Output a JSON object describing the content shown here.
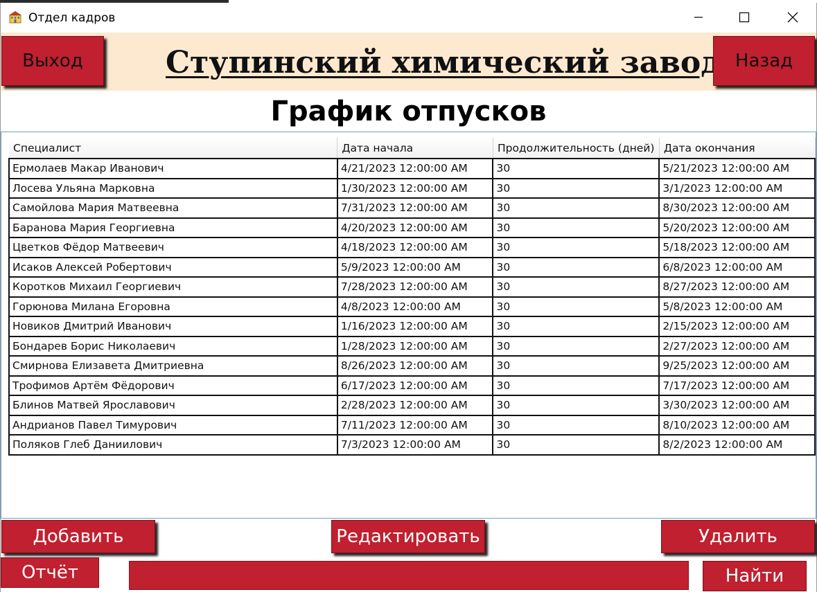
{
  "window": {
    "title": "Отдел кадров",
    "icon": "building-icon"
  },
  "header": {
    "exit_label": "Выход",
    "company": "Ступинский химический завод",
    "back_label": "Назад"
  },
  "page_title": "График отпусков",
  "table": {
    "columns": [
      "Специалист",
      "Дата начала",
      "Продолжительность (дней)",
      "Дата окончания"
    ],
    "rows": [
      [
        "Ермолаев Макар Иванович",
        "4/21/2023 12:00:00 AM",
        "30",
        "5/21/2023 12:00:00 AM"
      ],
      [
        "Лосева Ульяна Марковна",
        "1/30/2023 12:00:00 AM",
        "30",
        "3/1/2023 12:00:00 AM"
      ],
      [
        "Самойлова Мария Матвеевна",
        "7/31/2023 12:00:00 AM",
        "30",
        "8/30/2023 12:00:00 AM"
      ],
      [
        "Баранова Мария Георгиевна",
        "4/20/2023 12:00:00 AM",
        "30",
        "5/20/2023 12:00:00 AM"
      ],
      [
        "Цветков Фёдор Матвеевич",
        "4/18/2023 12:00:00 AM",
        "30",
        "5/18/2023 12:00:00 AM"
      ],
      [
        "Исаков Алексей Робертович",
        "5/9/2023 12:00:00 AM",
        "30",
        "6/8/2023 12:00:00 AM"
      ],
      [
        "Коротков Михаил Георгиевич",
        "7/28/2023 12:00:00 AM",
        "30",
        "8/27/2023 12:00:00 AM"
      ],
      [
        "Горюнова Милана Егоровна",
        "4/8/2023 12:00:00 AM",
        "30",
        "5/8/2023 12:00:00 AM"
      ],
      [
        "Новиков Дмитрий Иванович",
        "1/16/2023 12:00:00 AM",
        "30",
        "2/15/2023 12:00:00 AM"
      ],
      [
        "Бондарев Борис Николаевич",
        "1/28/2023 12:00:00 AM",
        "30",
        "2/27/2023 12:00:00 AM"
      ],
      [
        "Смирнова Елизавета Дмитриевна",
        "8/26/2023 12:00:00 AM",
        "30",
        "9/25/2023 12:00:00 AM"
      ],
      [
        "Трофимов Артём Фёдорович",
        "6/17/2023 12:00:00 AM",
        "30",
        "7/17/2023 12:00:00 AM"
      ],
      [
        "Блинов Матвей Ярославович",
        "2/28/2023 12:00:00 AM",
        "30",
        "3/30/2023 12:00:00 AM"
      ],
      [
        "Андрианов Павел Тимурович",
        "7/11/2023 12:00:00 AM",
        "30",
        "8/10/2023 12:00:00 AM"
      ],
      [
        "Поляков Глеб Даниилович",
        "7/3/2023 12:00:00 AM",
        "30",
        "8/2/2023 12:00:00 AM"
      ]
    ]
  },
  "actions": {
    "add_label": "Добавить",
    "edit_label": "Редактировать",
    "delete_label": "Удалить",
    "report_label": "Отчёт",
    "search_value": "",
    "find_label": "Найти"
  },
  "colors": {
    "button_red": "#c0202f",
    "header_bg": "#fde9cf",
    "grid_border": "#7a9bc6"
  }
}
